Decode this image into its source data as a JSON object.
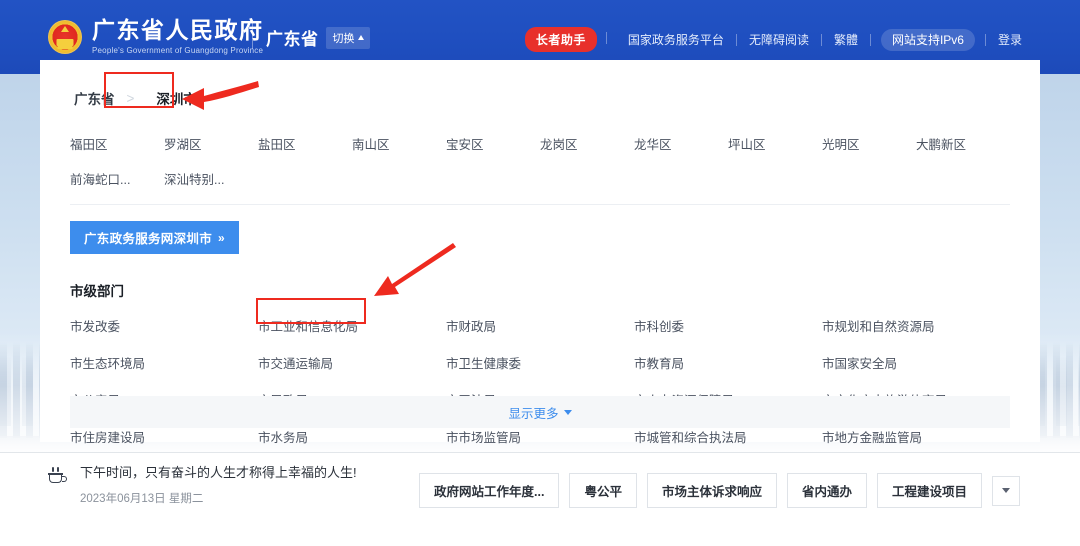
{
  "header": {
    "emblem_icon": "national-emblem-icon",
    "title_cn": "广东省人民政府",
    "title_en": "People's Government of Guangdong Province",
    "province_label": "广东省",
    "switch_label": "切换",
    "switch_caret_icon": "caret-up-icon",
    "links": {
      "elder_assistant": "长者助手",
      "national_platform": "国家政务服务平台",
      "accessible_reading": "无障碍阅读",
      "traditional": "繁體",
      "ipv6": "网站支持IPv6",
      "login": "登录"
    },
    "accent_red": "#e8302b",
    "brand_blue": "#1f4fc0"
  },
  "panel": {
    "region_tabs": [
      {
        "label": "广东省",
        "active": false
      },
      {
        "label": "深圳市",
        "active": true
      }
    ],
    "districts": [
      "福田区",
      "罗湖区",
      "盐田区",
      "南山区",
      "宝安区",
      "龙岗区",
      "龙华区",
      "坪山区",
      "光明区",
      "大鹏新区",
      "前海蛇口...",
      "深汕特别..."
    ],
    "service_button": {
      "label": "广东政务服务网深圳市",
      "chevron": "»"
    },
    "departments_title": "市级部门",
    "departments": [
      "市发改委",
      "市工业和信息化局",
      "市财政局",
      "市科创委",
      "市规划和自然资源局",
      "市生态环境局",
      "市交通运输局",
      "市卫生健康委",
      "市教育局",
      "市国家安全局",
      "市公安局",
      "市民政局",
      "市司法局",
      "市人力资源保障局",
      "市文化广电旅游体育局",
      "市住房建设局",
      "市水务局",
      "市市场监管局",
      "市城管和综合执法局",
      "市地方金融监管局"
    ],
    "show_more": {
      "label": "显示更多",
      "caret_icon": "caret-down-icon"
    },
    "highlight_color": "#ee2a1f"
  },
  "bottom": {
    "cup_icon": "coffee-cup-icon",
    "greeting": "下午时间，只有奋斗的人生才称得上幸福的人生!",
    "date": "2023年06月13日 星期二",
    "actions": [
      "政府网站工作年度...",
      "粤公平",
      "市场主体诉求响应",
      "省内通办",
      "工程建设项目"
    ],
    "more_caret_icon": "caret-down-icon"
  },
  "annotations": {
    "arrow_color": "#ee2a1f",
    "arrow_1_target": "深圳市",
    "arrow_2_target": "市工业和信息化局"
  }
}
